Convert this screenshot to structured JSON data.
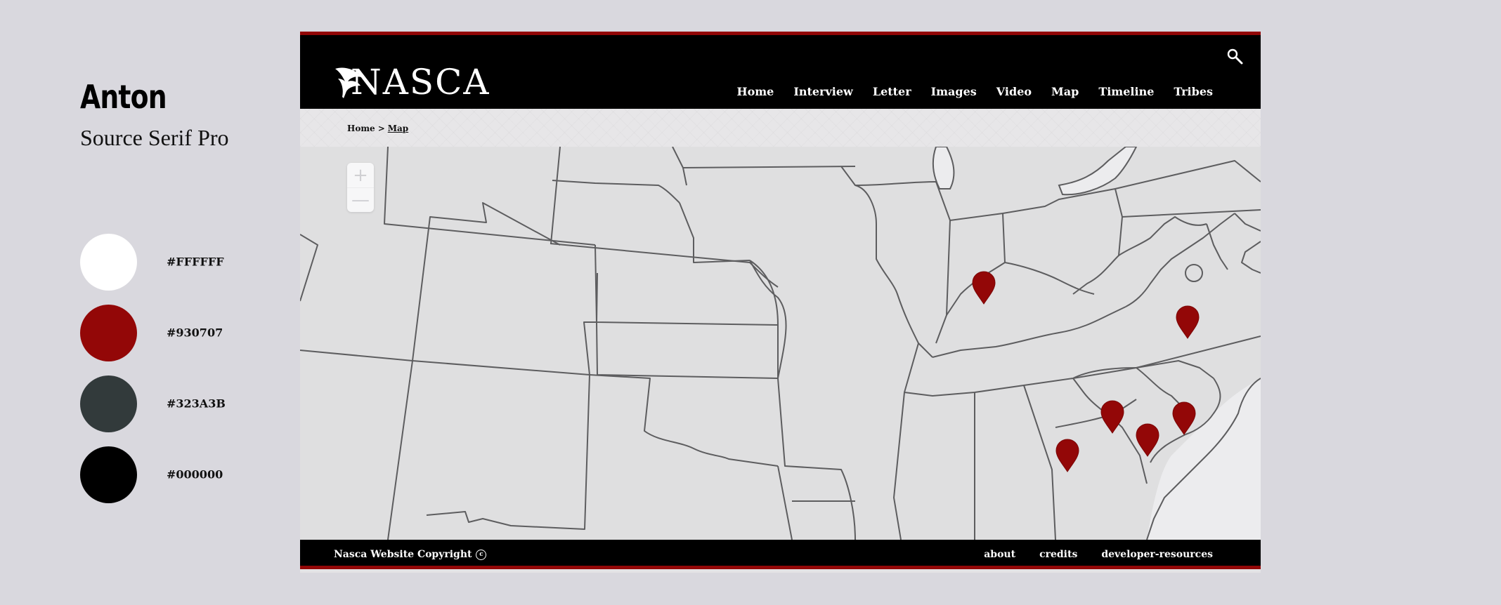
{
  "style_guide": {
    "fonts": [
      "Anton",
      "Source Serif Pro"
    ],
    "colors": [
      {
        "hex": "#FFFFFF",
        "label": "#FFFFFF"
      },
      {
        "hex": "#930707",
        "label": "#930707"
      },
      {
        "hex": "#323A3B",
        "label": "#323A3B"
      },
      {
        "hex": "#000000",
        "label": "#000000"
      }
    ]
  },
  "site": {
    "logo_text": "NASCA",
    "search_icon": "search-icon",
    "nav": [
      {
        "label": "Home",
        "active": false
      },
      {
        "label": "Interview",
        "active": false
      },
      {
        "label": "Letter",
        "active": false
      },
      {
        "label": "Images",
        "active": false
      },
      {
        "label": "Video",
        "active": false
      },
      {
        "label": "Map",
        "active": true
      },
      {
        "label": "Timeline",
        "active": false
      },
      {
        "label": "Tribes",
        "active": false
      }
    ],
    "breadcrumb": {
      "home": "Home",
      "separator": ">",
      "current": "Map"
    },
    "map": {
      "zoom_in": "+",
      "zoom_out": "—",
      "marker_count": 6,
      "marker_color": "#930707"
    },
    "footer": {
      "copyright": "Nasca Website Copyright",
      "copyright_symbol": "c",
      "links": [
        "about",
        "credits",
        "developer-resources"
      ]
    }
  },
  "colors": {
    "accent": "#930707",
    "header_bg": "#000000"
  }
}
